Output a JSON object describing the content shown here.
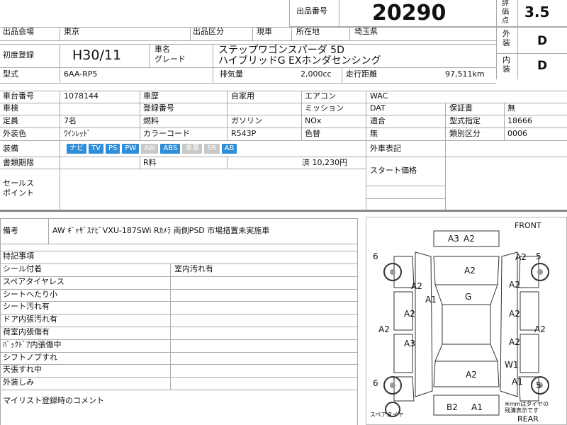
{
  "header": {
    "lot_label": "出品番号",
    "lot_no": "20290",
    "rating_label": "評価点",
    "rating": "3.5",
    "ext_label": "外装",
    "ext_grade": "D",
    "int_label": "内装",
    "int_grade": "D"
  },
  "row1": {
    "venue_label": "出品会場",
    "venue": "東京",
    "section_label": "出品区分",
    "section": "現車",
    "location_label": "所在地",
    "location": "埼玉県"
  },
  "vehicle": {
    "reg_label": "初度登録",
    "reg": "H30/11",
    "name_label": "車名",
    "grade_label": "グレード",
    "name": "ステップワゴンスパーダ 5D",
    "grade": "ハイブリッドG EXホンダセンシング",
    "model_label": "型式",
    "model": "6AA-RP5",
    "displacement_label": "排気量",
    "displacement": "2,000cc",
    "mileage_label": "走行距離",
    "mileage": "97,511km"
  },
  "details": {
    "chassis_label": "車台番号",
    "chassis": "1078144",
    "history_label": "車歴",
    "history": "自家用",
    "ac_label": "エアコン",
    "ac": "WAC",
    "inspection_label": "車検",
    "regno_label": "登録番号",
    "transmission_label": "ミッション",
    "transmission": "DAT",
    "warranty_label": "保証書",
    "warranty": "無",
    "capacity_label": "定員",
    "capacity": "7名",
    "fuel_label": "燃料",
    "fuel": "ガソリン",
    "nox_label": "NOx",
    "nox": "適合",
    "designation_label": "型式指定",
    "designation": "18666",
    "color_label": "外装色",
    "color": "ﾜｲﾝﾚｯﾄﾞ",
    "colorcode_label": "カラーコード",
    "colorcode": "R543P",
    "colorchange_label": "色替",
    "colorchange": "無",
    "category_label": "類別区分",
    "category": "0006",
    "equipment_label": "装備",
    "equipment": [
      "ナビ",
      "TV",
      "PS",
      "PW",
      "AW",
      "ABS",
      "本革",
      "SR",
      "AB"
    ],
    "equipment_on": [
      true,
      true,
      true,
      true,
      false,
      true,
      false,
      false,
      true
    ],
    "docs_label": "書類期限",
    "recycle_label": "R料",
    "recycle": "済 10,230円",
    "import_label": "外車表記",
    "start_label": "スタート価格",
    "sales_label": "セールス\nポイント"
  },
  "remarks": {
    "label": "備考",
    "text": "AW ｷﾞｬｻﾞｽﾅﾋﾞVXU-187SWi Rｶﾒﾗ 両側PSD 市場措置未実施車"
  },
  "special": {
    "header": "特記事項",
    "items": [
      {
        "label": "シール付着",
        "value": "室内汚れ有"
      },
      {
        "label": "スペアタイヤレス",
        "value": ""
      },
      {
        "label": "シートへたり小",
        "value": ""
      },
      {
        "label": "シート汚れ有",
        "value": ""
      },
      {
        "label": "ドア内張汚れ有",
        "value": ""
      },
      {
        "label": "荷室内張傷有",
        "value": ""
      },
      {
        "label": "ﾊﾞｯｸﾄﾞｱ内張傷中",
        "value": ""
      },
      {
        "label": "シフトノブすれ",
        "value": ""
      },
      {
        "label": "天張すれ中",
        "value": ""
      },
      {
        "label": "外装しみ",
        "value": ""
      }
    ],
    "comment_label": "マイリスト登録時のコメント"
  },
  "diagram": {
    "front": "FRONT",
    "rear": "REAR",
    "spare_label": "スペアタイヤ",
    "note": "※mmはタイヤの\n残溝表示です",
    "codes": {
      "front_a3": "A3",
      "front_a2": "A2",
      "hood": "A2",
      "windshield": "A1",
      "roof": "G",
      "right_front_fender": "A2",
      "right_front_door": "A2",
      "right_rear_door": "A2",
      "right_quarter": "A2",
      "left_front_fender": "A2",
      "left_front_door": "A2",
      "left_rear_door": "A2",
      "left_quarter": "A3",
      "left_mirror": "A2",
      "right_mirror_top": "A2",
      "rear_panel": "A2",
      "rear_glass": "W1",
      "rear_a1": "A1",
      "bumper_b2": "B2",
      "bumper_a1": "A1"
    },
    "tire_tl": "6",
    "tire_tr": "5",
    "tire_bl": "6",
    "tire_br": "5"
  }
}
